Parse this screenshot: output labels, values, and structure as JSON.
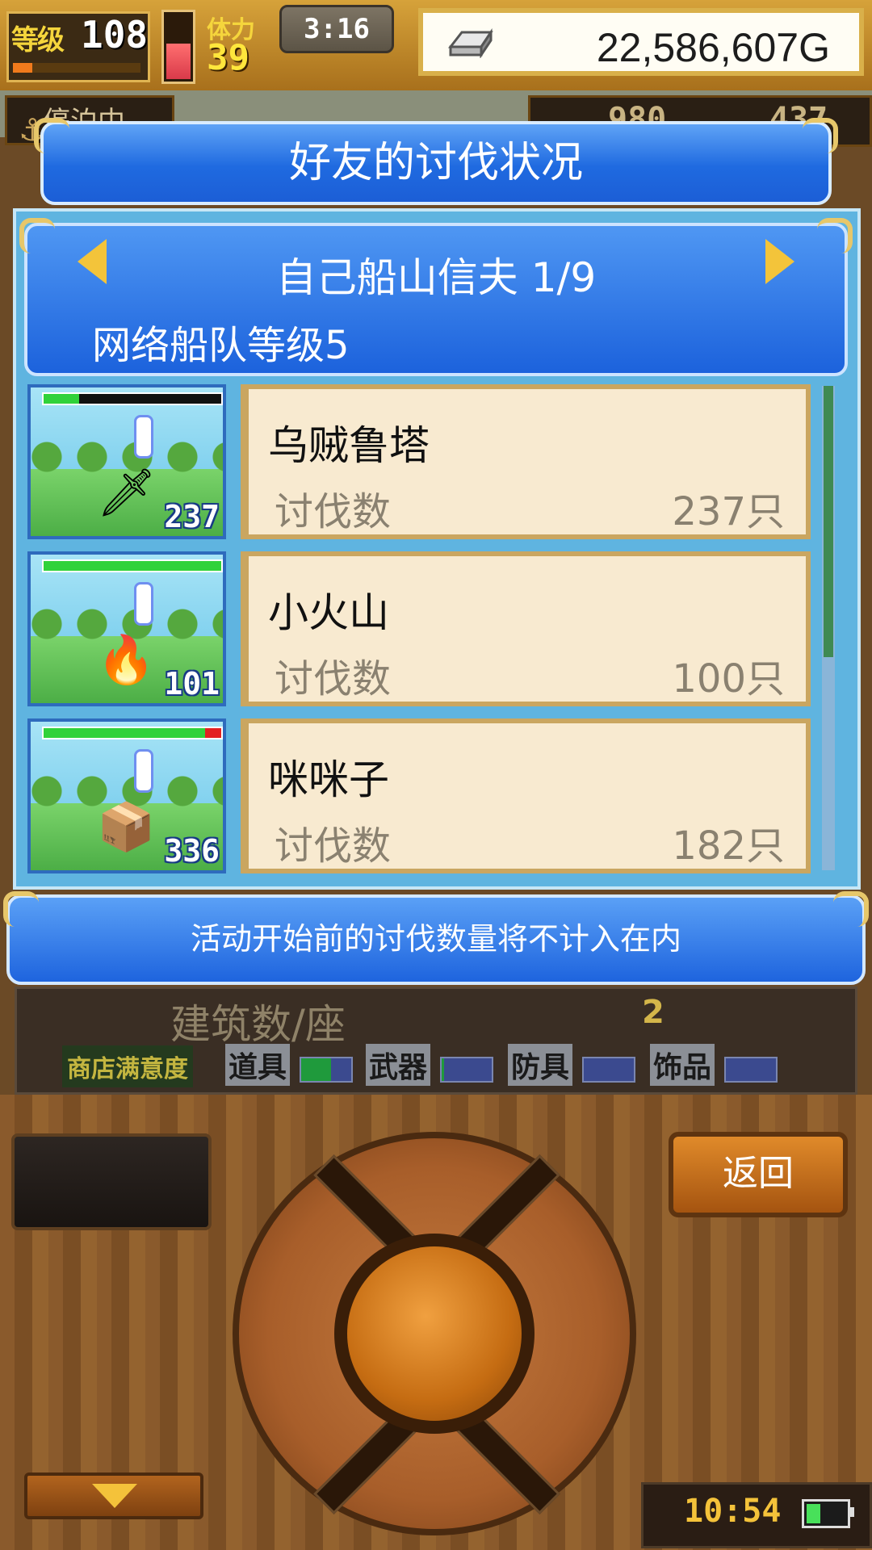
{
  "hud": {
    "level_label": "等级",
    "level_value": "108",
    "xp_progress": 0.15,
    "hp_fraction": 0.55,
    "stamina_label": "体力",
    "stamina_value": "39",
    "clock": "3:16",
    "gold_icon": "silver-ingot-icon",
    "gold_value": "22,586,607G",
    "dock_status": "停泊中",
    "resource_1": "980",
    "resource_2": "437"
  },
  "dialog": {
    "title": "好友的讨伐状况",
    "friend_name": "自己船山信夫 1/9",
    "fleet_level": "网络船队等级5",
    "prev_icon": "arrow-left-icon",
    "next_icon": "arrow-right-icon",
    "rows": [
      {
        "name": "乌贼鲁塔",
        "label": "讨伐数",
        "value": "237只",
        "badge": "237",
        "monster_icon": "sword-squid-icon",
        "monster_glyph": "🗡",
        "hp": 0.2,
        "hp_red": 0.0
      },
      {
        "name": "小火山",
        "label": "讨伐数",
        "value": "100只",
        "badge": "101",
        "monster_icon": "fire-spirit-icon",
        "monster_glyph": "🔥",
        "hp": 1.0,
        "hp_red": 0.0
      },
      {
        "name": "咪咪子",
        "label": "讨伐数",
        "value": "182只",
        "badge": "336",
        "monster_icon": "treasure-chest-cat-icon",
        "monster_glyph": "📦",
        "hp": 0.91,
        "hp_red": 0.09
      }
    ],
    "scroll_fraction": 0.56
  },
  "notice": "活动开始前的讨伐数量将不计入在内",
  "stats": {
    "building_label": "建筑数/座",
    "building_value": "2",
    "satisfaction_label": "商店满意度",
    "categories": [
      {
        "name": "道具",
        "level": 0.6
      },
      {
        "name": "武器",
        "level": 0.05
      },
      {
        "name": "防具",
        "level": 0.0
      },
      {
        "name": "饰品",
        "level": 0.0
      }
    ]
  },
  "controller": {
    "back_label": "返回",
    "device_time": "10:54",
    "battery_level": 0.35
  },
  "colors": {
    "dialog_blue": "#1f6ae0",
    "card_bg": "#f8ead0",
    "gold_accent": "#e7c76a"
  }
}
